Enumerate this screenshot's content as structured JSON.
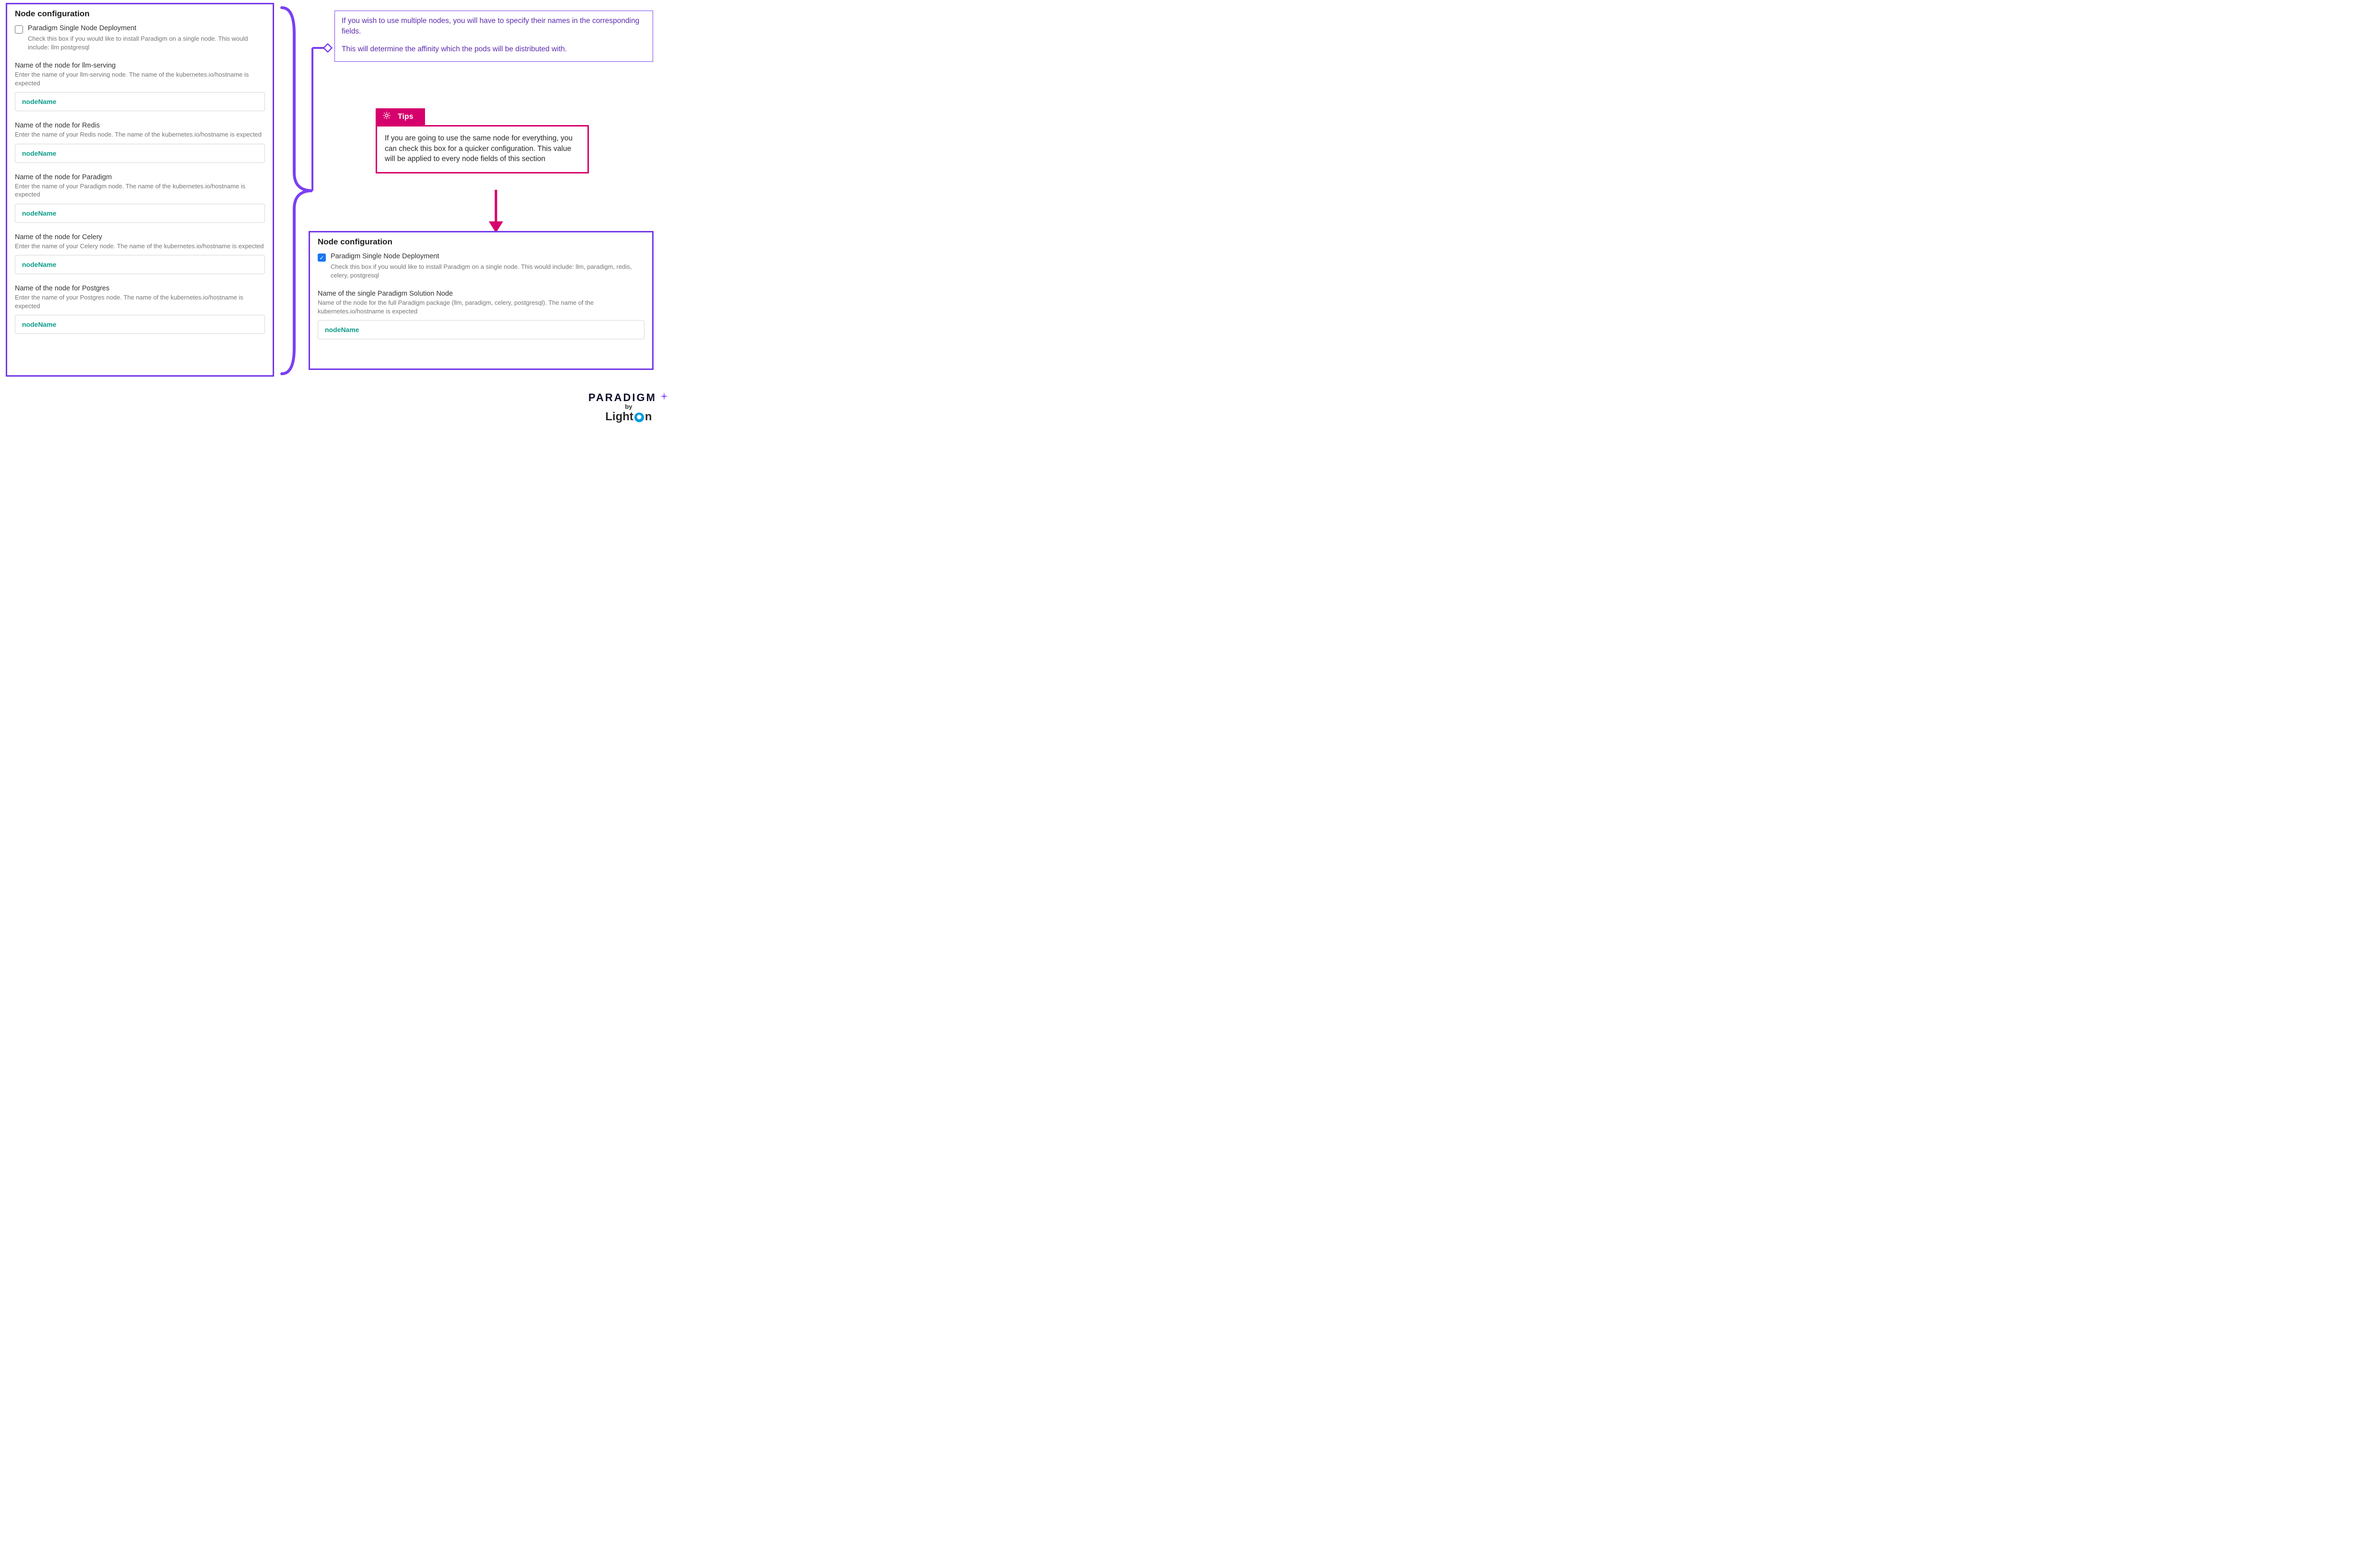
{
  "left_panel": {
    "title": "Node configuration",
    "checkbox": {
      "label": "Paradigm Single Node Deployment",
      "description": "Check this box if you would like to install Paradigm on a single node. This would include: llm postgresql",
      "checked": false
    },
    "fields": [
      {
        "label": "Name of the node for llm-serving",
        "description": "Enter the name of your llm-serving node. The name of the kubernetes.io/hostname is expected",
        "value": "nodeName"
      },
      {
        "label": "Name of the node for Redis",
        "description": "Enter the name of your Redis node. The name of the kubernetes.io/hostname is expected",
        "value": "nodeName"
      },
      {
        "label": "Name of the node for Paradigm",
        "description": "Enter the name of your Paradigm node. The name of the kubernetes.io/hostname is expected",
        "value": "nodeName"
      },
      {
        "label": "Name of the node for Celery",
        "description": "Enter the name of your Celery node. The name of the kubernetes.io/hostname is expected",
        "value": "nodeName"
      },
      {
        "label": "Name of the node for Postgres",
        "description": "Enter the name of your Postgres node. The name of the kubernetes.io/hostname is expected",
        "value": "nodeName"
      }
    ]
  },
  "callout": {
    "p1": "If you wish to use multiple nodes, you will have to specify their names in the corresponding fields.",
    "p2": "This will determine the affinity which the pods will be distributed with."
  },
  "tips": {
    "title": "Tips",
    "body": "If you are going to use the same node for everything, you can check this box for a quicker configuration. This value will be applied to every node fields of this section"
  },
  "right_panel": {
    "title": "Node configuration",
    "checkbox": {
      "label": "Paradigm Single Node Deployment",
      "description": "Check this box if you would like to install Paradigm on a single node. This would include: llm, paradigm, redis, celery, postgresql",
      "checked": true
    },
    "field": {
      "label": "Name of the single Paradigm Solution Node",
      "description": "Name of the node for the full Paradigm package (llm, paradigm, celery, postgresql). The name of the kubernetes.io/hostname is expected",
      "value": "nodeName"
    }
  },
  "logo": {
    "line1": "PARADIGM",
    "by": "by",
    "brand_pre": "Light",
    "brand_post": "n"
  }
}
